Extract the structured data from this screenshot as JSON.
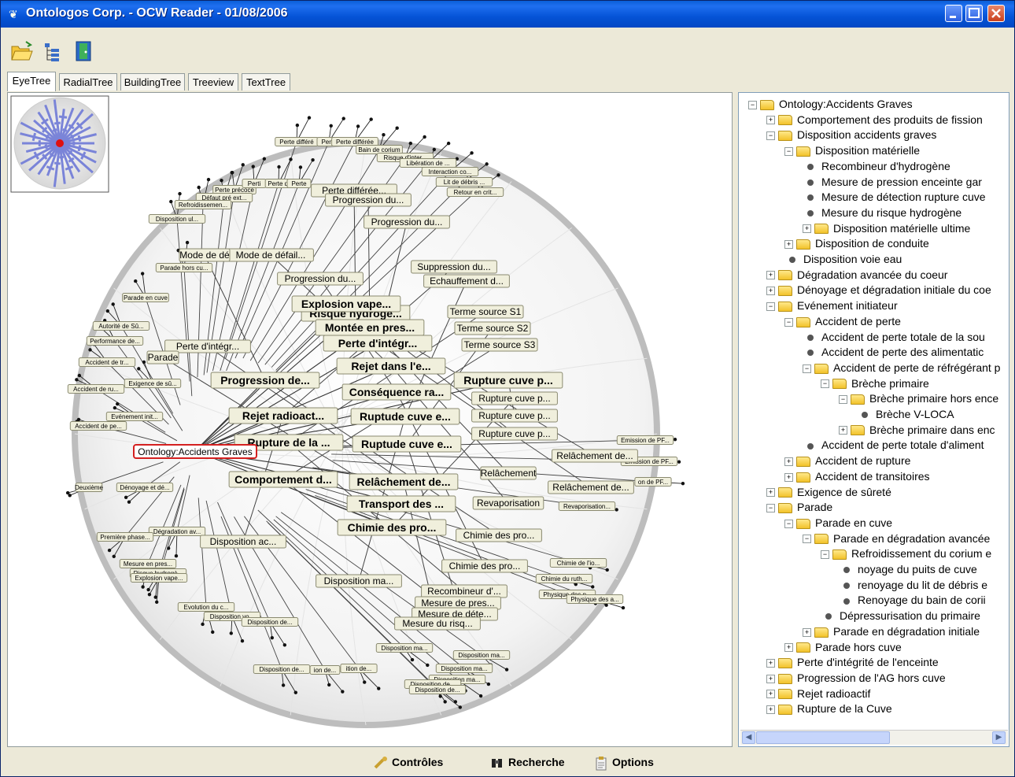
{
  "window": {
    "title": "Ontologos Corp. - OCW Reader - 01/08/2006"
  },
  "tabs": [
    "EyeTree",
    "RadialTree",
    "BuildingTree",
    "Treeview",
    "TextTree"
  ],
  "graph": {
    "root_label": "Ontology:Accidents Graves",
    "nodes_big": [
      "Risque hydrogè...",
      "Montée en pres...",
      "Perte d'intégr...",
      "Rejet dans l'e...",
      "Progression de...",
      "Conséquence ra...",
      "Rejet radioact...",
      "Ruptude cuve e...",
      "Rupture de la ...",
      "Ruptude cuve e...",
      "Comportement d...",
      "Relâchement de...",
      "Transport des ...",
      "Chimie des pro...",
      "Rupture cuve p...",
      "Explosion vape..."
    ],
    "nodes_med": [
      "Perte différée...",
      "Progression du...",
      "Progression du...",
      "Mode de défail...",
      "Mode de dé",
      "Progression du...",
      "Suppression du...",
      "Echauffement d...",
      "Terme source S1",
      "Terme source S2",
      "Terme source S3",
      "Perte d'intégr...",
      "Parade",
      "Rupture cuve p...",
      "Rupture cuve p...",
      "Rupture cuve p...",
      "Relâchement de...",
      "Relâchement",
      "Relâchement de...",
      "Revaporisation",
      "Chimie des pro...",
      "Chimie des pro...",
      "Disposition ac...",
      "Disposition ma...",
      "Recombineur d'...",
      "Mesure de pres...",
      "Mesure de déte...",
      "Mesure du risq..."
    ],
    "nodes_small": [
      "Perte différé",
      "Perte",
      "Perte différée",
      "Bain de corium",
      "Risque d'inter...",
      "Libération de ...",
      "Interaction co...",
      "Lit de débris ...",
      "Retour en crit...",
      "Perte précoce",
      "Défaut pré ext...",
      "Refroidissemen...",
      "Perti",
      "Perte d'",
      "Perte",
      "Disposition ul...",
      "Parade hors cu...",
      "Parade en cuve",
      "Autorité de Sû...",
      "Performance de...",
      "Accident de tr...",
      "Exigence de sû...",
      "Accident de ru...",
      "Evénement init...",
      "Accident de pe...",
      "Deuxième",
      "Dénoyage et dé...",
      "Dégradation av...",
      "Première phase...",
      "Mesure en pres...",
      "Risque hydrogè...",
      "Explosion vape...",
      "Evolution du c...",
      "Disposition vo...",
      "Disposition de...",
      "Emission de PF...",
      "Emission de PF...",
      "on de PF...",
      "Revaporisation...",
      "Chimie de l'io...",
      "Chimie du ruth...",
      "Physique des p...",
      "Physique des a...",
      "Disposition ma...",
      "Disposition ma...",
      "Disposition ma...",
      "Disposition de...",
      "ion de...",
      "ition de...",
      "Disposition ma...",
      "Disposition de...",
      "Disposition de..."
    ]
  },
  "tree": {
    "rows": [
      {
        "label": "Ontology:Accidents Graves",
        "level": 0,
        "kind": "folder",
        "exp": "−"
      },
      {
        "label": "Comportement des produits de fission",
        "level": 1,
        "kind": "folder",
        "exp": "+"
      },
      {
        "label": "Disposition accidents graves",
        "level": 1,
        "kind": "folder",
        "exp": "−"
      },
      {
        "label": "Disposition matérielle",
        "level": 2,
        "kind": "folder",
        "exp": "−"
      },
      {
        "label": "Recombineur d'hydrogène",
        "level": 3,
        "kind": "leaf"
      },
      {
        "label": "Mesure de pression enceinte gar",
        "level": 3,
        "kind": "leaf"
      },
      {
        "label": "Mesure de détection rupture cuve",
        "level": 3,
        "kind": "leaf"
      },
      {
        "label": "Mesure du risque hydrogène",
        "level": 3,
        "kind": "leaf"
      },
      {
        "label": "Disposition matérielle ultime",
        "level": 3,
        "kind": "folder",
        "exp": "+"
      },
      {
        "label": "Disposition de conduite",
        "level": 2,
        "kind": "folder",
        "exp": "+"
      },
      {
        "label": "Disposition voie eau",
        "level": 2,
        "kind": "leaf"
      },
      {
        "label": "Dégradation avancée du coeur",
        "level": 1,
        "kind": "folder",
        "exp": "+"
      },
      {
        "label": "Dénoyage et dégradation initiale du coe",
        "level": 1,
        "kind": "folder",
        "exp": "+"
      },
      {
        "label": "Evénement initiateur",
        "level": 1,
        "kind": "folder",
        "exp": "−"
      },
      {
        "label": "Accident de perte",
        "level": 2,
        "kind": "folder",
        "exp": "−"
      },
      {
        "label": "Accident de perte totale de la sou",
        "level": 3,
        "kind": "leaf"
      },
      {
        "label": "Accident de perte des alimentatic",
        "level": 3,
        "kind": "leaf"
      },
      {
        "label": "Accident de perte de réfrégérant p",
        "level": 3,
        "kind": "folder",
        "exp": "−"
      },
      {
        "label": "Brèche primaire",
        "level": 4,
        "kind": "folder",
        "exp": "−"
      },
      {
        "label": "Brèche primaire hors ence",
        "level": 5,
        "kind": "folder",
        "exp": "−"
      },
      {
        "label": "Brèche V-LOCA",
        "level": 6,
        "kind": "leaf"
      },
      {
        "label": "Brèche primaire dans enc",
        "level": 5,
        "kind": "folder",
        "exp": "+"
      },
      {
        "label": "Accident de perte totale d'aliment",
        "level": 3,
        "kind": "leaf"
      },
      {
        "label": "Accident de rupture",
        "level": 2,
        "kind": "folder",
        "exp": "+"
      },
      {
        "label": "Accident de transitoires",
        "level": 2,
        "kind": "folder",
        "exp": "+"
      },
      {
        "label": "Exigence de sûreté",
        "level": 1,
        "kind": "folder",
        "exp": "+"
      },
      {
        "label": "Parade",
        "level": 1,
        "kind": "folder",
        "exp": "−"
      },
      {
        "label": "Parade en cuve",
        "level": 2,
        "kind": "folder",
        "exp": "−"
      },
      {
        "label": "Parade en dégradation avancée",
        "level": 3,
        "kind": "folder",
        "exp": "−"
      },
      {
        "label": "Refroidissement du corium e",
        "level": 4,
        "kind": "folder",
        "exp": "−"
      },
      {
        "label": "noyage du puits de cuve",
        "level": 5,
        "kind": "leaf"
      },
      {
        "label": "renoyage du lit de débris e",
        "level": 5,
        "kind": "leaf"
      },
      {
        "label": "Renoyage du bain de corii",
        "level": 5,
        "kind": "leaf"
      },
      {
        "label": "Dépressurisation du primaire",
        "level": 4,
        "kind": "leaf"
      },
      {
        "label": "Parade en dégradation initiale",
        "level": 3,
        "kind": "folder",
        "exp": "+"
      },
      {
        "label": "Parade hors cuve",
        "level": 2,
        "kind": "folder",
        "exp": "+"
      },
      {
        "label": "Perte d'intégrité de l'enceinte",
        "level": 1,
        "kind": "folder",
        "exp": "+"
      },
      {
        "label": "Progression de l'AG hors cuve",
        "level": 1,
        "kind": "folder",
        "exp": "+"
      },
      {
        "label": "Rejet radioactif",
        "level": 1,
        "kind": "folder",
        "exp": "+"
      },
      {
        "label": "Rupture de la Cuve",
        "level": 1,
        "kind": "folder",
        "exp": "+"
      }
    ]
  },
  "bottom": {
    "controls": "Contrôles",
    "search": "Recherche",
    "options": "Options"
  }
}
